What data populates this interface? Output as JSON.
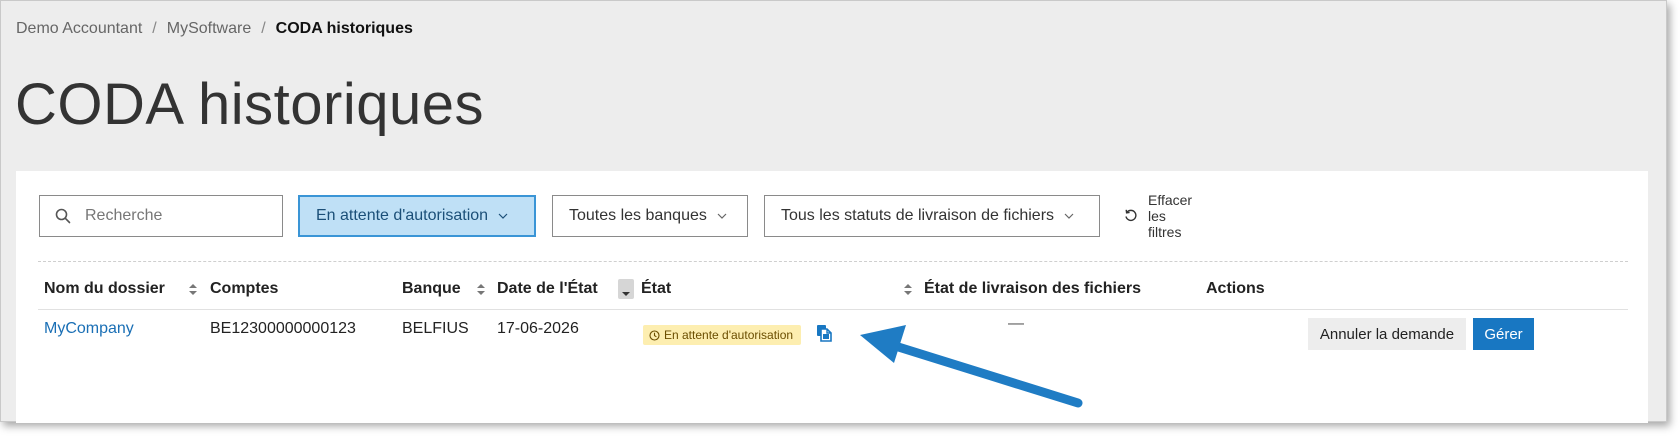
{
  "breadcrumb": {
    "items": [
      "Demo Accountant",
      "MySoftware"
    ],
    "current": "CODA historiques",
    "separator": "/"
  },
  "page_title": "CODA historiques",
  "filters": {
    "search_placeholder": "Recherche",
    "status_filter": "En attente d'autorisation",
    "bank_filter": "Toutes les banques",
    "delivery_filter": "Tous les statuts de livraison de fichiers",
    "clear_label": "Effacer les filtres"
  },
  "table": {
    "columns": {
      "dossier": "Nom du dossier",
      "comptes": "Comptes",
      "banque": "Banque",
      "date": "Date de l'État",
      "etat": "État",
      "livraison": "État de livraison des fichiers",
      "actions": "Actions"
    },
    "rows": [
      {
        "dossier": "MyCompany",
        "comptes": "BE12300000000123",
        "banque": "BELFIUS",
        "date": "17-06-2026",
        "etat": "En attente d'autorisation",
        "livraison": "—",
        "cancel_label": "Annuler la demande",
        "manage_label": "Gérer"
      }
    ]
  },
  "colors": {
    "accent": "#1877c2",
    "link": "#1a6fb5",
    "active_filter_bg": "#bfe0f6",
    "badge_bg": "#fdeeb0",
    "annotation_arrow": "#1f7cc4"
  },
  "icons": {
    "search": "search-icon",
    "chevron": "chevron-down-icon",
    "reset": "reset-icon",
    "sort": "sort-icon",
    "clock": "clock-icon",
    "copy": "copy-icon"
  }
}
